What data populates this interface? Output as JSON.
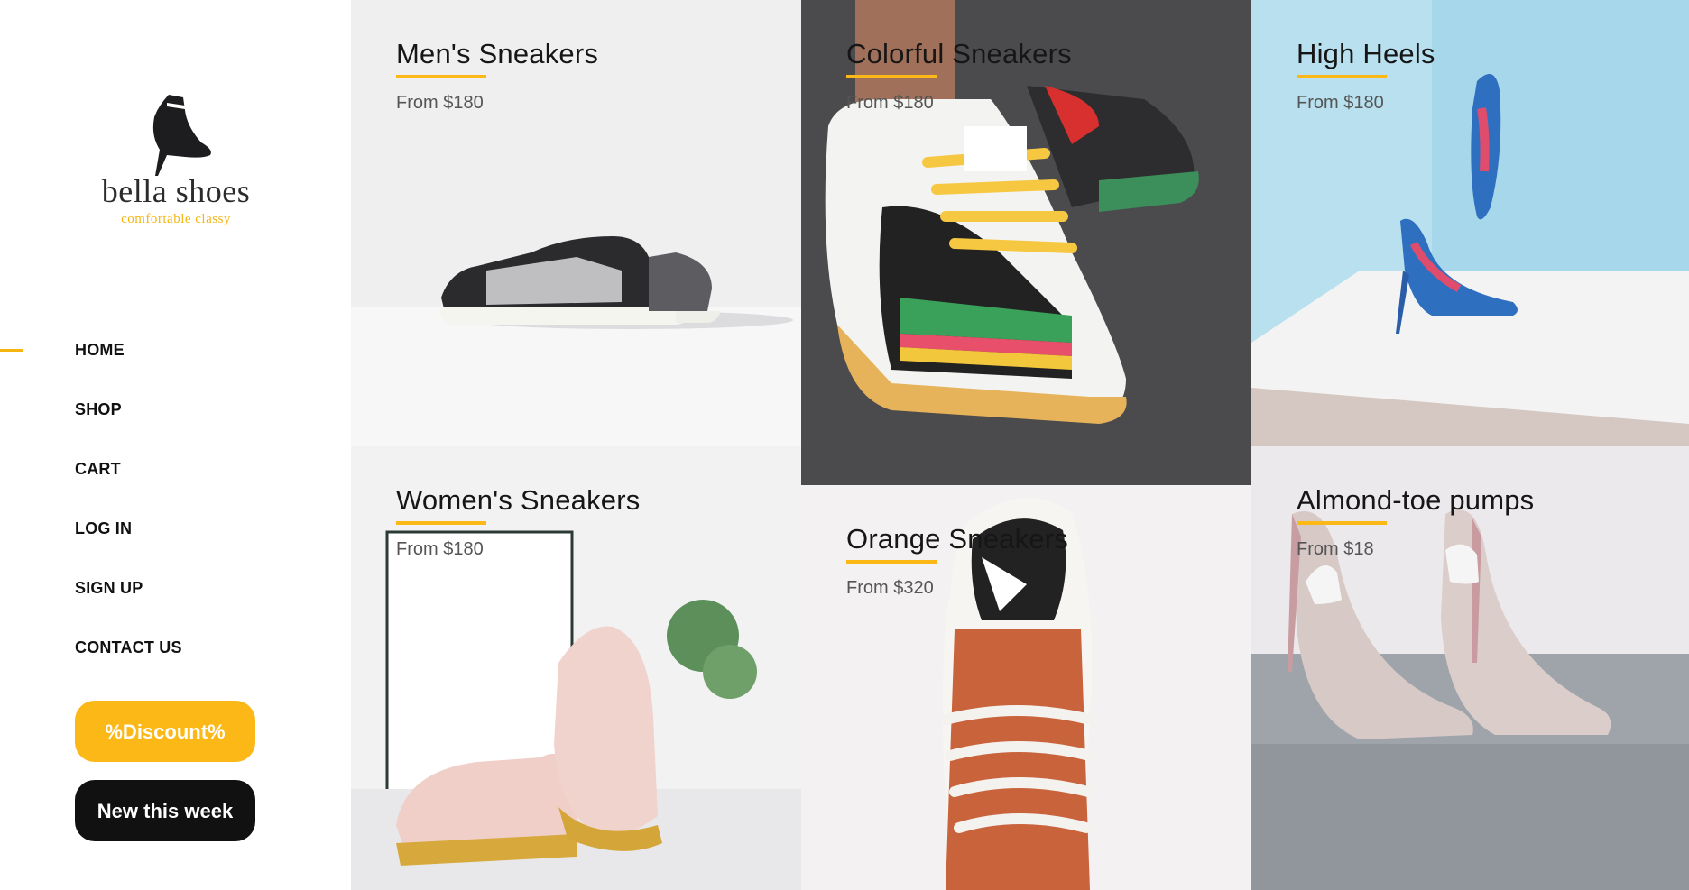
{
  "brand": {
    "name": "bella shoes",
    "tagline": "comfortable classy",
    "logo_icon": "high-heel-boot-icon"
  },
  "nav": {
    "items": [
      {
        "label": "HOME",
        "active": true
      },
      {
        "label": "SHOP",
        "active": false
      },
      {
        "label": "CART",
        "active": false
      },
      {
        "label": "LOG IN",
        "active": false
      },
      {
        "label": "SIGN UP",
        "active": false
      },
      {
        "label": "CONTACT US",
        "active": false
      }
    ]
  },
  "buttons": {
    "discount": "%Discount%",
    "new_this_week": "New this week"
  },
  "colors": {
    "accent": "#fbb817",
    "dark_button": "#111111"
  },
  "products": [
    {
      "title": "Men's Sneakers",
      "price": "From $180"
    },
    {
      "title": "Colorful Sneakers",
      "price": "From $180"
    },
    {
      "title": "High Heels",
      "price": "From $180"
    },
    {
      "title": "Women's Sneakers",
      "price": "From $180"
    },
    {
      "title": "Orange Sneakers",
      "price": "From $320"
    },
    {
      "title": "Almond-toe pumps",
      "price": "From $18"
    }
  ]
}
